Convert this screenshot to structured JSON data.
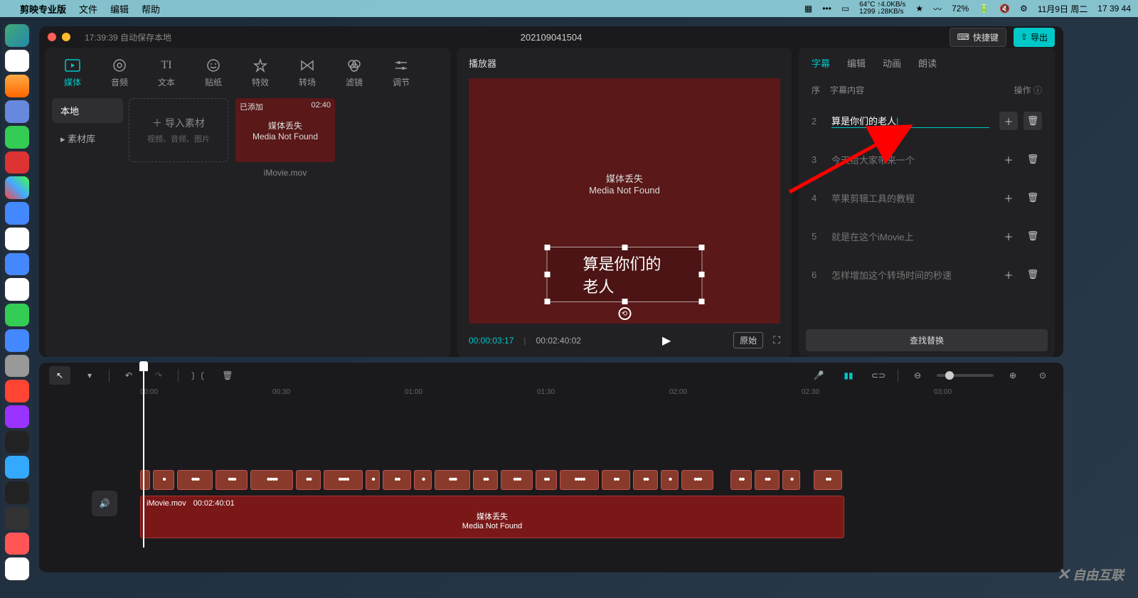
{
  "menubar": {
    "app_name": "剪映专业版",
    "menus": [
      "文件",
      "编辑",
      "帮助"
    ],
    "temp": "64°C",
    "net_up": "↑4.0KB/s",
    "net_dn": "↓28KB/s",
    "cpu": "1299",
    "battery": "72%",
    "date": "11月9日 周二",
    "time": "17 39 44"
  },
  "window": {
    "autosave": "17:39:39 自动保存本地",
    "title": "202109041504",
    "hotkey_label": "快捷键",
    "export_label": "导出"
  },
  "tool_tabs": [
    {
      "label": "媒体"
    },
    {
      "label": "音频"
    },
    {
      "label": "文本"
    },
    {
      "label": "贴纸"
    },
    {
      "label": "特效"
    },
    {
      "label": "转场"
    },
    {
      "label": "滤镜"
    },
    {
      "label": "调节"
    }
  ],
  "media_sidebar": [
    {
      "label": "本地",
      "active": true
    },
    {
      "label": "素材库",
      "active": false
    }
  ],
  "import": {
    "label": "导入素材",
    "hint": "视频、音频、图片"
  },
  "clip": {
    "badge": "已添加",
    "duration": "02:40",
    "line1": "媒体丢失",
    "line2": "Media Not Found",
    "name": "iMovie.mov"
  },
  "player": {
    "header": "播放器",
    "line1": "媒体丢失",
    "line2": "Media Not Found",
    "subtitle": "算是你们的老人",
    "timecode": "00:00:03:17",
    "duration": "00:02:40:02",
    "ratio": "原始"
  },
  "inspector": {
    "tabs": [
      "字幕",
      "编辑",
      "动画",
      "朗读"
    ],
    "col_seq": "序",
    "col_content": "字幕内容",
    "col_ops": "操作",
    "rows": [
      {
        "num": "2",
        "text": "算是你们的老人",
        "active": true
      },
      {
        "num": "3",
        "text": "今天给大家带来一个"
      },
      {
        "num": "4",
        "text": "苹果剪辑工具的教程"
      },
      {
        "num": "5",
        "text": "就是在这个iMovie上"
      },
      {
        "num": "6",
        "text": "怎样增加这个转场时间的秒速"
      }
    ],
    "find_replace": "查找替换"
  },
  "ruler": [
    "00:00",
    "00:30",
    "01:00",
    "01:30",
    "02:00",
    "02:30",
    "03:00"
  ],
  "video_track": {
    "name": "iMovie.mov",
    "duration": "00:02:40:01",
    "line1": "媒体丢失",
    "line2": "Media Not Found"
  },
  "watermark": "自由互联"
}
